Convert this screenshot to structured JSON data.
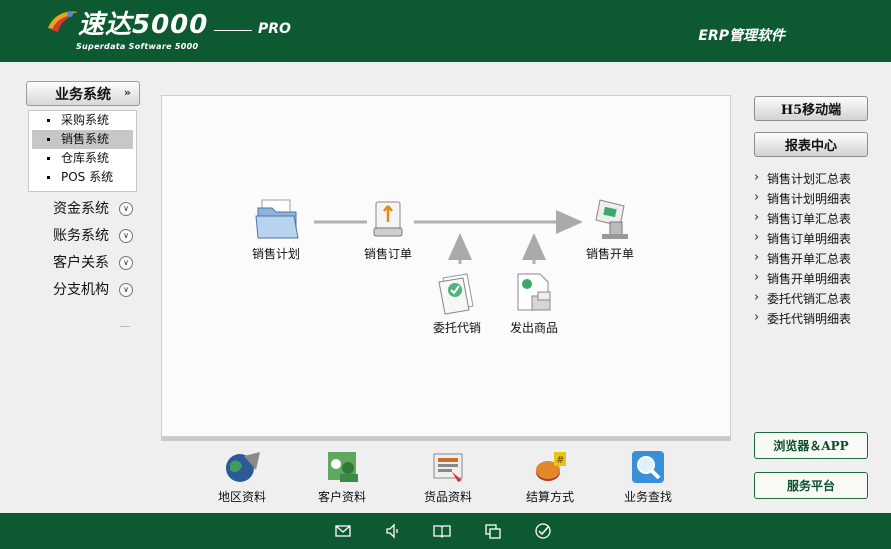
{
  "header": {
    "logo_main": "速达5000",
    "logo_pro": "PRO",
    "logo_sub": "Superdata Software 5000",
    "title_right": "ERP管理软件"
  },
  "sidebar": {
    "business": {
      "label": "业务系统",
      "expanded": true
    },
    "subsystems": [
      {
        "label": "采购系统",
        "active": false
      },
      {
        "label": "销售系统",
        "active": true
      },
      {
        "label": "仓库系统",
        "active": false
      },
      {
        "label": "POS 系统",
        "active": false
      }
    ],
    "groups": [
      {
        "label": "资金系统"
      },
      {
        "label": "账务系统"
      },
      {
        "label": "客户关系"
      },
      {
        "label": "分支机构"
      }
    ]
  },
  "flow": {
    "nodes": {
      "sales_plan": "销售计划",
      "sales_order": "销售订单",
      "sales_invoice": "销售开单",
      "consignment": "委托代销",
      "shipped_goods": "发出商品"
    }
  },
  "toolbar": [
    {
      "label": "地区资料",
      "icon": "globe-icon"
    },
    {
      "label": "客户资料",
      "icon": "customers-icon"
    },
    {
      "label": "货品资料",
      "icon": "goods-icon"
    },
    {
      "label": "结算方式",
      "icon": "settlement-icon"
    },
    {
      "label": "业务查找",
      "icon": "search-icon"
    }
  ],
  "right": {
    "h5_button": "H5移动端",
    "report_center": "报表中心",
    "reports": [
      "销售计划汇总表",
      "销售计划明细表",
      "销售订单汇总表",
      "销售订单明细表",
      "销售开单汇总表",
      "销售开单明细表",
      "委托代销汇总表",
      "委托代销明细表"
    ],
    "browser_app": "浏览器＆APP",
    "service_platform": "服务平台"
  },
  "footer_icons": [
    "mail-icon",
    "speaker-icon",
    "book-icon",
    "windows-icon",
    "check-icon"
  ],
  "colors": {
    "brand_green": "#0d5a32",
    "accent_gray": "#c7c7c7"
  }
}
